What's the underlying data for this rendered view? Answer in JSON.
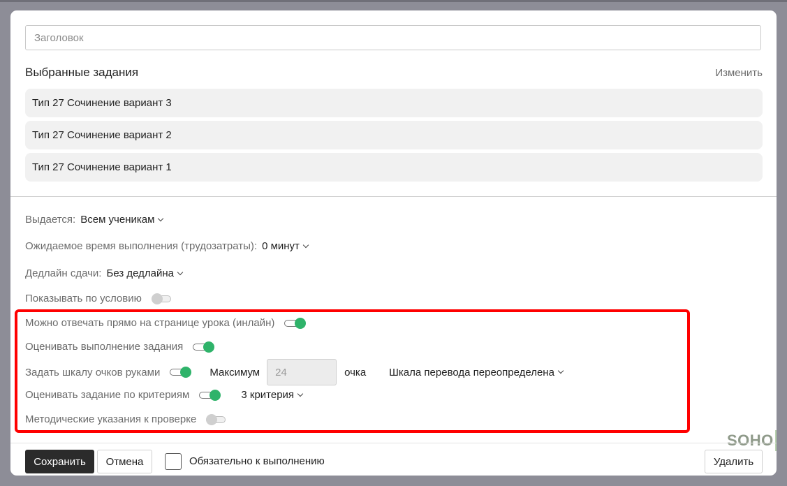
{
  "form": {
    "title_placeholder": "Заголовок",
    "selected_tasks_title": "Выбранные задания",
    "edit_label": "Изменить",
    "tasks": [
      {
        "label": "Тип 27 Сочинение вариант 3"
      },
      {
        "label": "Тип 27 Сочинение вариант 2"
      },
      {
        "label": "Тип 27 Сочинение вариант 1"
      }
    ]
  },
  "settings": {
    "issued_label": "Выдается:",
    "issued_value": "Всем ученикам",
    "time_label": "Ожидаемое время выполнения (трудозатраты):",
    "time_value": "0 минут",
    "deadline_label": "Дедлайн сдачи:",
    "deadline_value": "Без дедлайна",
    "conditional_label": "Показывать по условию",
    "conditional_on": false,
    "inline_label": "Можно отвечать прямо на странице урока (инлайн)",
    "inline_on": true,
    "grade_label": "Оценивать выполнение задания",
    "grade_on": true,
    "manual_scale_label": "Задать шкалу очков руками",
    "manual_scale_on": true,
    "max_label": "Максимум",
    "max_value": "24",
    "points_label": "очка",
    "scale_override": "Шкала перевода переопределена",
    "criteria_label": "Оценивать задание по критериям",
    "criteria_on": true,
    "criteria_value": "3 критерия",
    "guidelines_label": "Методические указания к проверке",
    "guidelines_on": false
  },
  "footer": {
    "save_label": "Сохранить",
    "cancel_label": "Отмена",
    "required_label": "Обязательно к выполнению",
    "required_checked": false,
    "delete_label": "Удалить"
  },
  "watermark": {
    "text": "SOHO"
  },
  "colors": {
    "toggle_on": "#2fb36a",
    "highlight": "#ff0000",
    "primary_button": "#2b2b2b"
  }
}
